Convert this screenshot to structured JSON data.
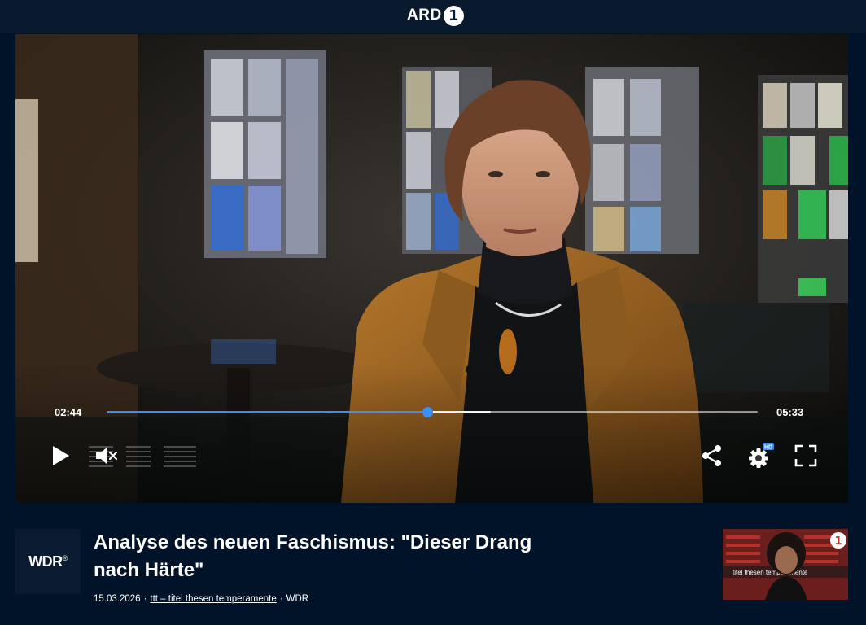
{
  "header": {
    "logo_text": "ARD",
    "logo_mark": "1"
  },
  "player": {
    "current_time": "02:44",
    "total_time": "05:33",
    "progress_fraction": 0.492,
    "buffered_fraction": 0.59,
    "controls": {
      "play": "play-icon",
      "mute": "speaker-muted-icon",
      "share": "share-icon",
      "settings": "gear-icon",
      "settings_badge": "HD",
      "fullscreen": "fullscreen-icon"
    },
    "colors": {
      "accent": "#3d8ef5"
    }
  },
  "video": {
    "channel": "WDR",
    "title": "Analyse des neuen Faschismus: \"Dieser Drang nach Härte\"",
    "date": "15.03.2026",
    "show": "ttt – titel thesen temperamente",
    "broadcaster": "WDR",
    "separator": "·"
  },
  "sidebar_thumbnail": {
    "caption": "titel thesen temperamente",
    "logo_mark": "1"
  }
}
